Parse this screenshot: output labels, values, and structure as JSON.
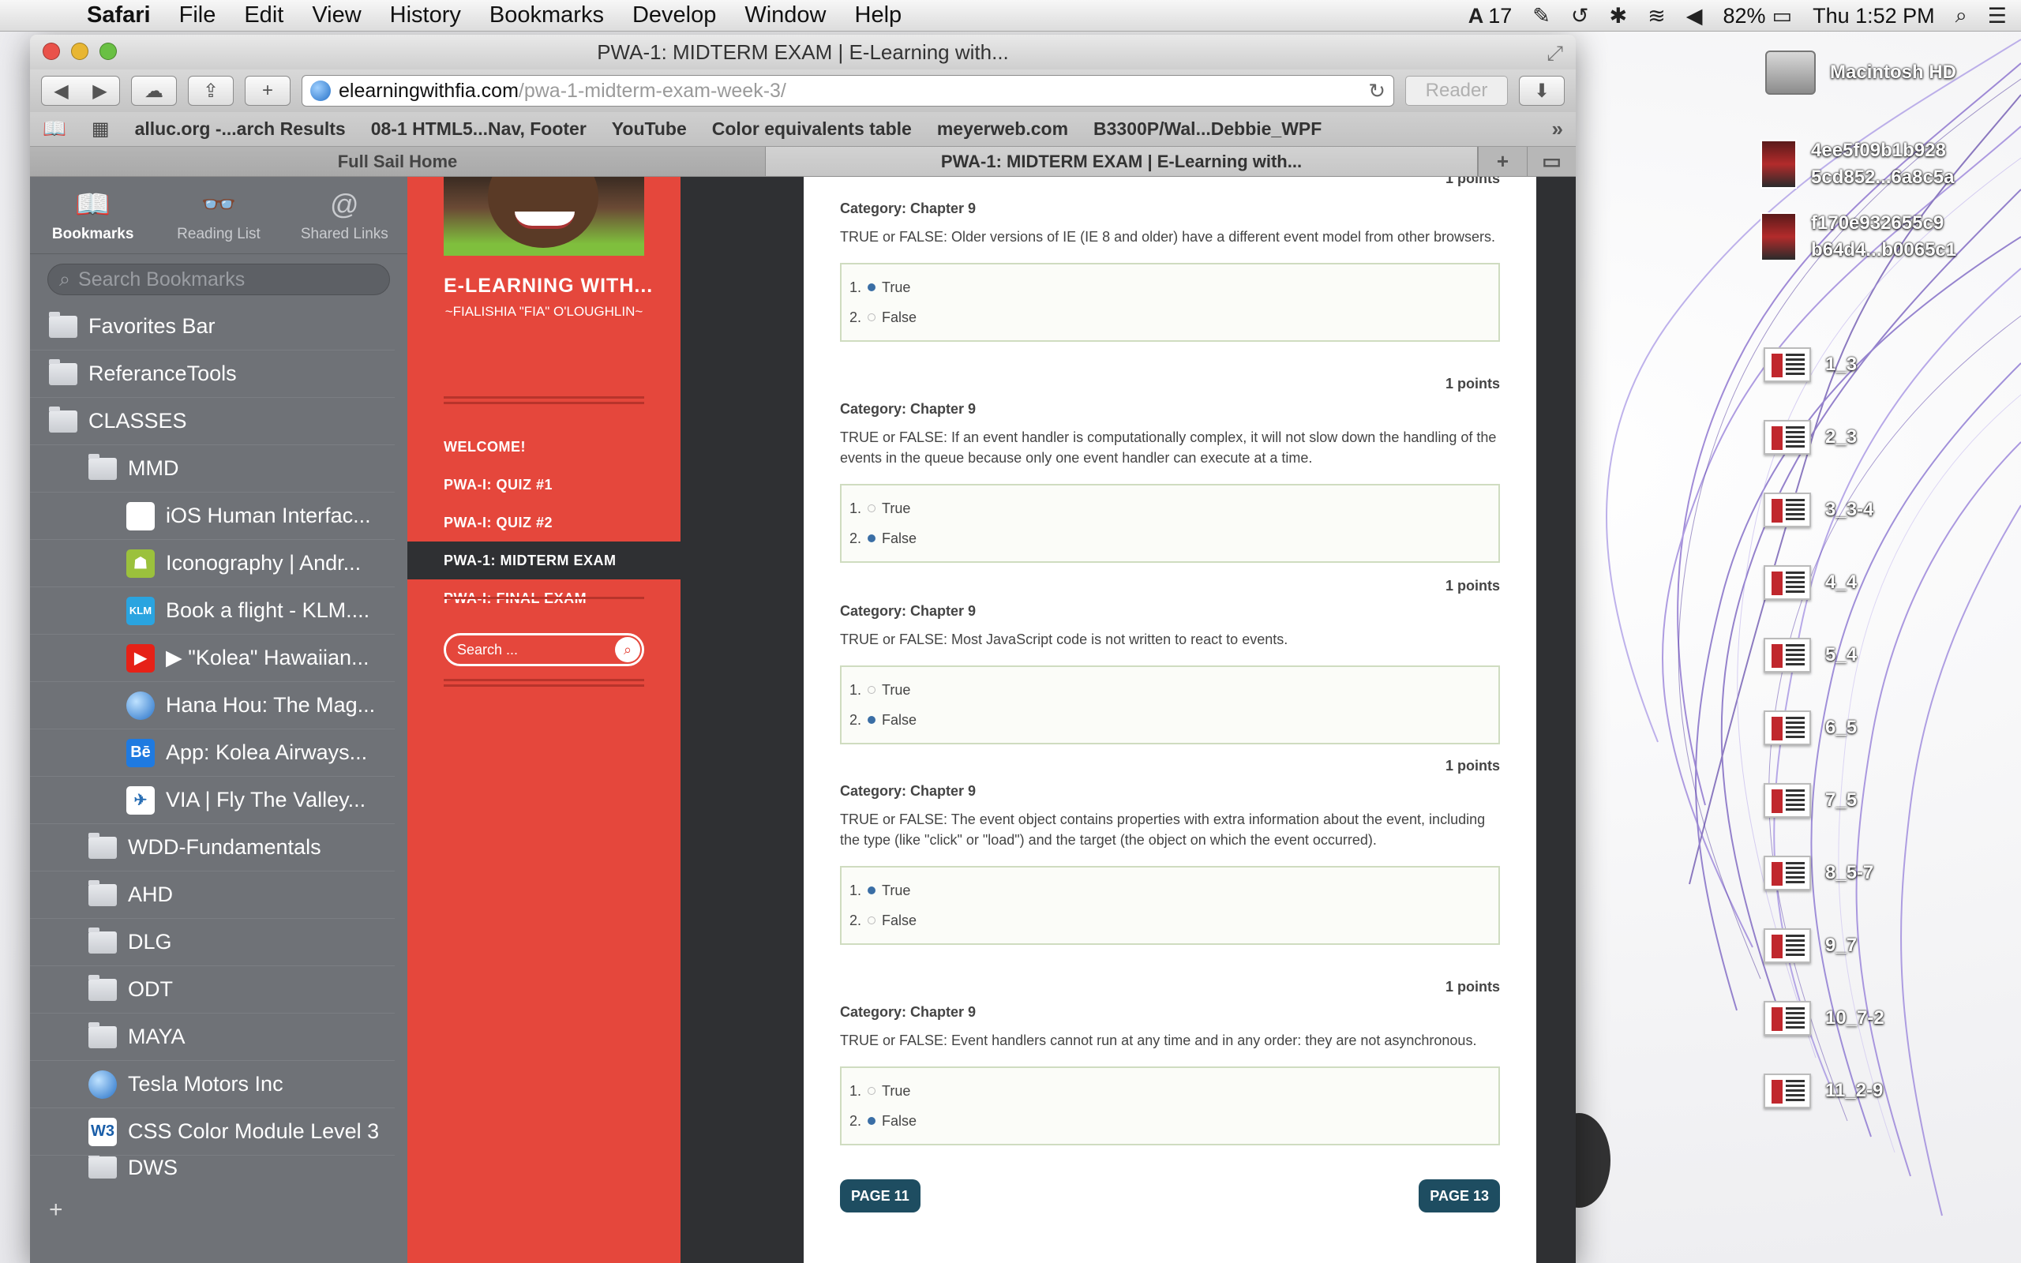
{
  "menubar": {
    "app": "Safari",
    "items": [
      "File",
      "Edit",
      "View",
      "History",
      "Bookmarks",
      "Develop",
      "Window",
      "Help"
    ],
    "status": {
      "adobe_count": "17",
      "battery": "82%",
      "clock": "Thu 1:52 PM"
    }
  },
  "window": {
    "title": "PWA-1: MIDTERM EXAM | E-Learning with...",
    "url_host": "elearningwithfia.com",
    "url_path": "/pwa-1-midterm-exam-week-3/",
    "reader_label": "Reader",
    "favorites": [
      "alluc.org -...arch Results",
      "08-1 HTML5...Nav, Footer",
      "YouTube",
      "Color equivalents table",
      "meyerweb.com",
      "B3300P/Wal...Debbie_WPF"
    ],
    "tabs": [
      {
        "label": "Full Sail Home"
      },
      {
        "label": "PWA-1: MIDTERM EXAM | E-Learning with..."
      }
    ]
  },
  "sidebar": {
    "tabs": [
      {
        "label": "Bookmarks",
        "icon": "open-book-icon"
      },
      {
        "label": "Reading List",
        "icon": "glasses-icon"
      },
      {
        "label": "Shared Links",
        "icon": "at-icon"
      }
    ],
    "search_placeholder": "Search Bookmarks",
    "items": [
      {
        "label": "Favorites Bar"
      },
      {
        "label": "ReferanceTools"
      },
      {
        "label": "CLASSES"
      },
      {
        "label": "MMD"
      },
      {
        "label": "iOS Human Interfac..."
      },
      {
        "label": "Iconography | Andr..."
      },
      {
        "label": "Book a flight - KLM...."
      },
      {
        "label": "▶ \"Kolea\" Hawaiian..."
      },
      {
        "label": "Hana Hou: The Mag..."
      },
      {
        "label": "App: Kolea Airways..."
      },
      {
        "label": "VIA | Fly The Valley..."
      },
      {
        "label": "WDD-Fundamentals"
      },
      {
        "label": "AHD"
      },
      {
        "label": "DLG"
      },
      {
        "label": "ODT"
      },
      {
        "label": "MAYA"
      },
      {
        "label": "Tesla Motors Inc"
      },
      {
        "label": "CSS Color Module Level 3"
      },
      {
        "label": "DWS"
      }
    ],
    "add_label": "+"
  },
  "site": {
    "title": "E-LEARNING WITH...",
    "subtitle": "~FIALISHIA \"FIA\" O'LOUGHLIN~",
    "nav": [
      "WELCOME!",
      "PWA-I: QUIZ #1",
      "PWA-I: QUIZ #2",
      "PWA-1: MIDTERM EXAM",
      "PWA-I: FINAL EXAM"
    ],
    "search_placeholder": "Search ..."
  },
  "exam": {
    "questions": [
      {
        "points": "1 points",
        "category": "Category: Chapter 9",
        "text": "TRUE or FALSE:  Older versions of IE (IE 8 and older) have a different event model from other browsers.",
        "answers": [
          "1. ",
          "True",
          "2. ",
          "False"
        ],
        "selected": 0
      },
      {
        "points": "1 points",
        "category": "Category: Chapter 9",
        "text": "TRUE or FALSE:  If an event handler is computationally complex, it will not slow down the handling of the events in the queue because only one event handler can execute at a time.",
        "answers": [
          "1. ",
          "True",
          "2. ",
          "False"
        ],
        "selected": 1
      },
      {
        "points": "1 points",
        "category": "Category: Chapter 9",
        "text": "TRUE or FALSE: Most JavaScript code is not written to react to events.",
        "answers": [
          "1. ",
          "True",
          "2. ",
          "False"
        ],
        "selected": 1
      },
      {
        "points": "1 points",
        "category": "Category: Chapter 9",
        "text": "TRUE or FALSE:  The event object contains properties with extra information about the event, including the type (like \"click\" or \"load\") and the target (the object on which the event occurred).",
        "answers": [
          "1. ",
          "True",
          "2. ",
          "False"
        ],
        "selected": 0
      },
      {
        "points": "1 points",
        "category": "Category: Chapter 9",
        "text": "TRUE or FALSE:  Event handlers cannot run at any time and in any order: they are not asynchronous.",
        "answers": [
          "1. ",
          "True",
          "2. ",
          "False"
        ],
        "selected": 1
      }
    ],
    "prev_label": "PAGE 11",
    "next_label": "PAGE 13"
  },
  "desktop": {
    "drive": "Macintosh HD",
    "thumbs": [
      "4ee5f09b1b928 5cd852...6a8c5a",
      "f170e932655c9 b64d4...b0065c1"
    ],
    "files": [
      "1_3",
      "2_3",
      "3_3-4",
      "4_4",
      "5_4",
      "6_5",
      "7_5",
      "8_5-7",
      "9_7",
      "10_7-2",
      "11_2-9"
    ]
  }
}
